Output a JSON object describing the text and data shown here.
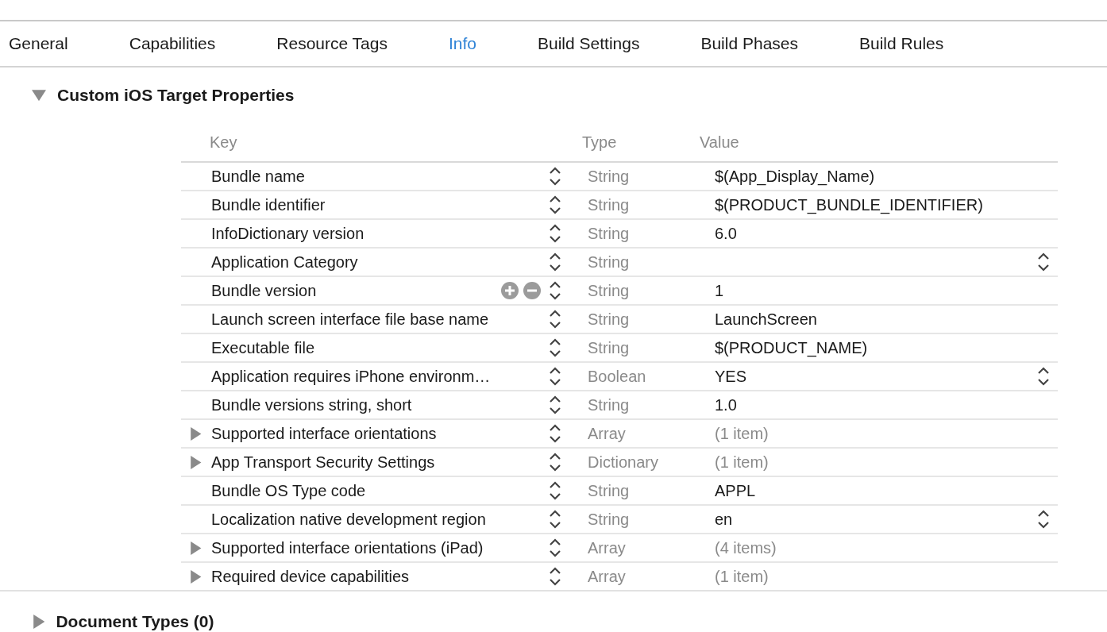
{
  "tabs": [
    {
      "label": "General",
      "selected": false
    },
    {
      "label": "Capabilities",
      "selected": false
    },
    {
      "label": "Resource Tags",
      "selected": false
    },
    {
      "label": "Info",
      "selected": true
    },
    {
      "label": "Build Settings",
      "selected": false
    },
    {
      "label": "Build Phases",
      "selected": false
    },
    {
      "label": "Build Rules",
      "selected": false
    }
  ],
  "section": {
    "title": "Custom iOS Target Properties",
    "expanded": true
  },
  "table": {
    "columns": [
      "Key",
      "Type",
      "Value"
    ],
    "rows": [
      {
        "kind": "scalar",
        "key": "Bundle name",
        "type": "String",
        "value": "$(App_Display_Name)",
        "hovered": false
      },
      {
        "kind": "scalar",
        "key": "Bundle identifier",
        "type": "String",
        "value": "$(PRODUCT_BUNDLE_IDENTIFIER)",
        "hovered": false
      },
      {
        "kind": "scalar",
        "key": "InfoDictionary version",
        "type": "String",
        "value": "6.0",
        "hovered": false
      },
      {
        "kind": "choice",
        "key": "Application Category",
        "type": "String",
        "value": "",
        "hovered": false
      },
      {
        "kind": "scalar",
        "key": "Bundle version",
        "type": "String",
        "value": "1",
        "hovered": true
      },
      {
        "kind": "scalar",
        "key": "Launch screen interface file base name",
        "type": "String",
        "value": "LaunchScreen",
        "hovered": false
      },
      {
        "kind": "scalar",
        "key": "Executable file",
        "type": "String",
        "value": "$(PRODUCT_NAME)",
        "hovered": false
      },
      {
        "kind": "choice",
        "key": "Application requires iPhone environm…",
        "type": "Boolean",
        "value": "YES",
        "hovered": false
      },
      {
        "kind": "scalar",
        "key": "Bundle versions string, short",
        "type": "String",
        "value": "1.0",
        "hovered": false
      },
      {
        "kind": "collection",
        "key": "Supported interface orientations",
        "type": "Array",
        "value": "(1 item)",
        "hovered": false
      },
      {
        "kind": "collection",
        "key": "App Transport Security Settings",
        "type": "Dictionary",
        "value": "(1 item)",
        "hovered": false
      },
      {
        "kind": "scalar",
        "key": "Bundle OS Type code",
        "type": "String",
        "value": "APPL",
        "hovered": false
      },
      {
        "kind": "choice",
        "key": "Localization native development region",
        "type": "String",
        "value": "en",
        "hovered": false
      },
      {
        "kind": "collection",
        "key": "Supported interface orientations (iPad)",
        "type": "Array",
        "value": "(4 items)",
        "hovered": false
      },
      {
        "kind": "collection",
        "key": "Required device capabilities",
        "type": "Array",
        "value": "(1 item)",
        "hovered": false
      }
    ]
  },
  "next_section": {
    "title": "Document Types (0)",
    "expanded": false
  }
}
